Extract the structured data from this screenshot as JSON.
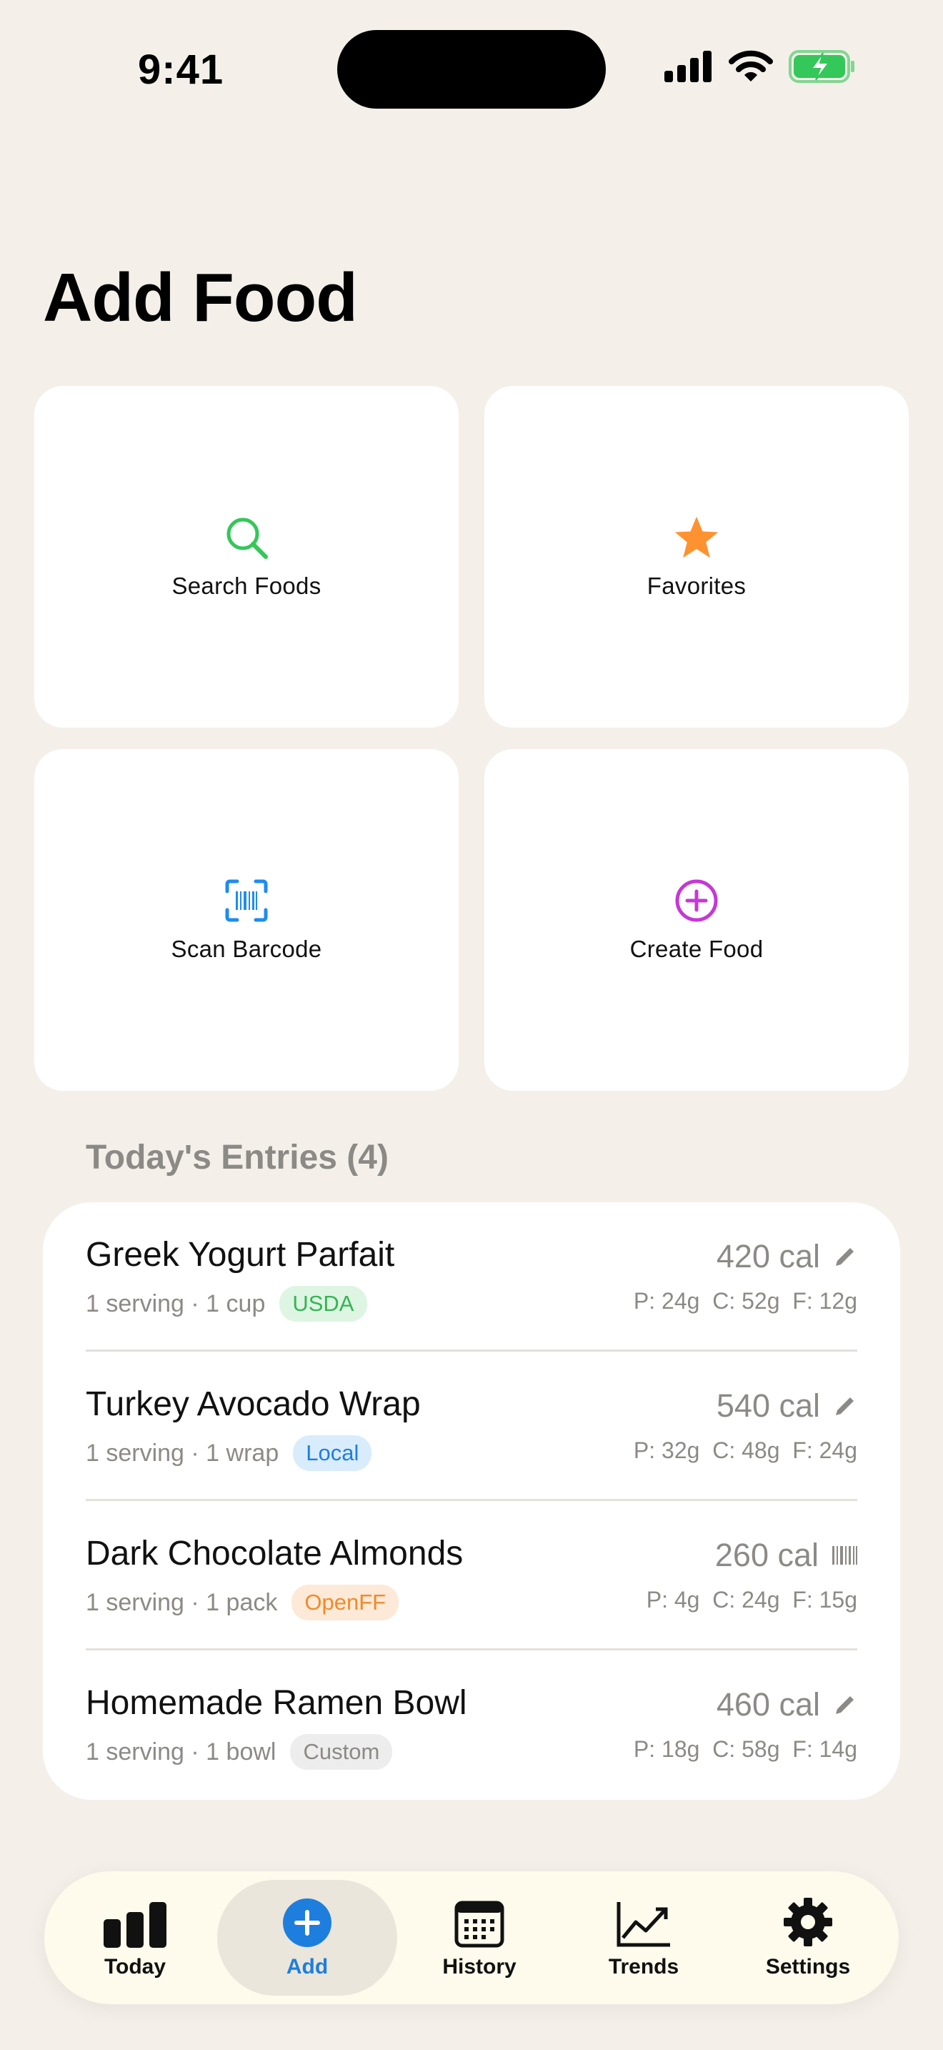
{
  "status_bar": {
    "time": "9:41"
  },
  "page": {
    "title": "Add Food"
  },
  "actions": [
    {
      "label": "Search Foods",
      "icon": "search-icon",
      "color": "#34C759"
    },
    {
      "label": "Favorites",
      "icon": "star-icon",
      "color": "#FF9230"
    },
    {
      "label": "Scan Barcode",
      "icon": "barcode-scan-icon",
      "color": "#1E8CF0"
    },
    {
      "label": "Create Food",
      "icon": "plus-circle-icon",
      "color": "#C737D6"
    }
  ],
  "entries_section": {
    "header": "Today's Entries (4)"
  },
  "entries": [
    {
      "name": "Greek Yogurt Parfait",
      "serving": "1 serving · 1 cup",
      "source": "USDA",
      "calories": "420 cal",
      "macros": "P: 24g  C: 52g  F: 12g",
      "action_icon": "pencil-icon"
    },
    {
      "name": "Turkey Avocado Wrap",
      "serving": "1 serving · 1 wrap",
      "source": "Local",
      "calories": "540 cal",
      "macros": "P: 32g  C: 48g  F: 24g",
      "action_icon": "pencil-icon"
    },
    {
      "name": "Dark Chocolate Almonds",
      "serving": "1 serving · 1 pack",
      "source": "OpenFF",
      "calories": "260 cal",
      "macros": "P: 4g  C: 24g  F: 15g",
      "action_icon": "barcode-icon"
    },
    {
      "name": "Homemade Ramen Bowl",
      "serving": "1 serving · 1 bowl",
      "source": "Custom",
      "calories": "460 cal",
      "macros": "P: 18g  C: 58g  F: 14g",
      "action_icon": "pencil-icon"
    }
  ],
  "badge_colors": {
    "USDA": {
      "bg": "#DDF5E2",
      "fg": "#34B552"
    },
    "Local": {
      "bg": "#D9ECFB",
      "fg": "#1E7EDD"
    },
    "OpenFF": {
      "bg": "#FDE9D7",
      "fg": "#F08A2B"
    },
    "Custom": {
      "bg": "#EDEDED",
      "fg": "#8C8A86"
    }
  },
  "tabs": [
    {
      "label": "Today",
      "icon": "bar-chart-icon",
      "active": false
    },
    {
      "label": "Add",
      "icon": "plus-circle-filled-icon",
      "active": true
    },
    {
      "label": "History",
      "icon": "calendar-icon",
      "active": false
    },
    {
      "label": "Trends",
      "icon": "trend-line-icon",
      "active": false
    },
    {
      "label": "Settings",
      "icon": "gear-icon",
      "active": false
    }
  ],
  "colors": {
    "accent": "#1E7EDD",
    "background": "#F4F0E9"
  }
}
